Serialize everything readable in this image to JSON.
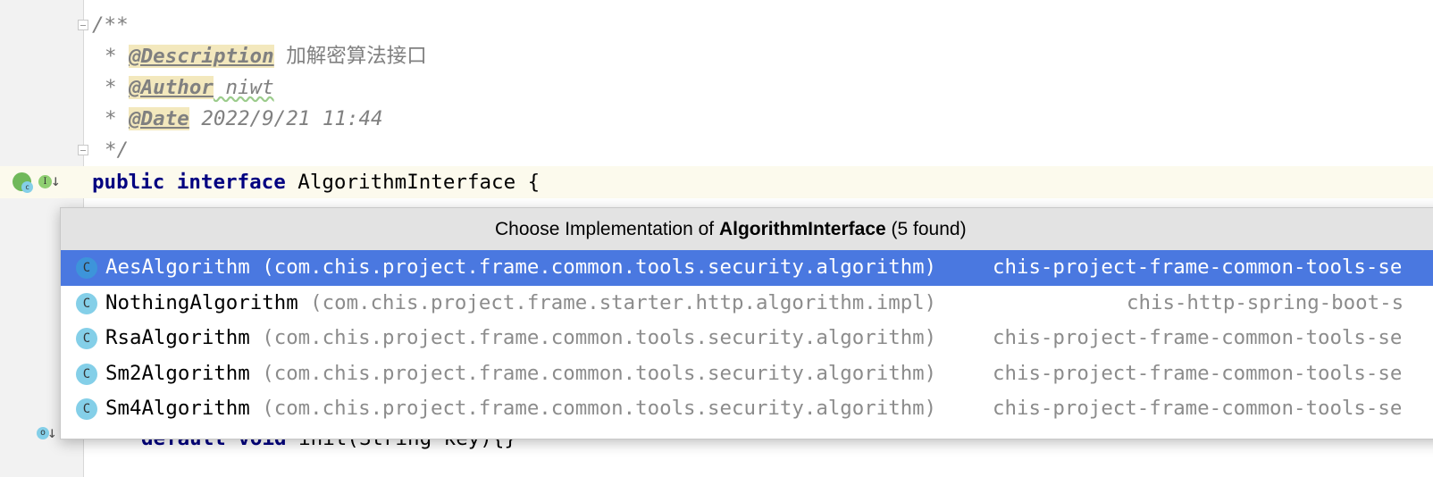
{
  "editor": {
    "lines": {
      "doc_open": "/**",
      "star": "* ",
      "description_tag": "@Description",
      "description_text": " 加解密算法接口",
      "author_tag": "@Author",
      "author_text": " niwt",
      "date_tag": "@Date",
      "date_text": " 2022/9/21 11:44",
      "doc_close": "*/",
      "kw_public": "public",
      "kw_interface": "interface",
      "interface_name": " AlgorithmInterface {",
      "method_line_keywords": "default void",
      "method_line_rest": " init(String key){}"
    },
    "gutter_icons": [
      "implemented-icon",
      "interface-icon",
      "overriding-method-icon"
    ]
  },
  "popup": {
    "title_prefix": "Choose Implementation of ",
    "title_bold": "AlgorithmInterface",
    "title_suffix": " (5 found)",
    "items": [
      {
        "icon": "C",
        "name": "AesAlgorithm",
        "package": " (com.chis.project.frame.common.tools.security.algorithm)",
        "module": "chis-project-frame-common-tools-se",
        "selected": true
      },
      {
        "icon": "C",
        "name": "NothingAlgorithm",
        "package": " (com.chis.project.frame.starter.http.algorithm.impl)",
        "module": "chis-http-spring-boot-s",
        "selected": false
      },
      {
        "icon": "C",
        "name": "RsaAlgorithm",
        "package": " (com.chis.project.frame.common.tools.security.algorithm)",
        "module": "chis-project-frame-common-tools-se",
        "selected": false
      },
      {
        "icon": "C",
        "name": "Sm2Algorithm",
        "package": " (com.chis.project.frame.common.tools.security.algorithm)",
        "module": "chis-project-frame-common-tools-se",
        "selected": false
      },
      {
        "icon": "C",
        "name": "Sm4Algorithm",
        "package": " (com.chis.project.frame.common.tools.security.algorithm)",
        "module": "chis-project-frame-common-tools-se",
        "selected": false
      }
    ]
  },
  "colors": {
    "selection": "#4a78e0",
    "class_icon": "#84cfe8",
    "keyword": "#000080",
    "doc_tag_bg": "#f3e8bd"
  }
}
